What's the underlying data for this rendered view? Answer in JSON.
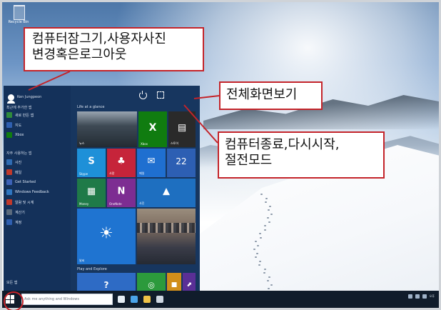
{
  "desktop": {
    "recycle_bin_label": "Recycle Bin"
  },
  "start_menu": {
    "user_name": "Ken Jungpeon",
    "left_sections": [
      {
        "label": "최근에 추가한 앱"
      },
      {
        "label": "자주 사용하는 앱"
      }
    ],
    "left_items": [
      {
        "label": "새로 만든 앱",
        "color": "#2f8a3c"
      },
      {
        "label": "지도",
        "color": "#2f5fb0"
      },
      {
        "label": "Xbox",
        "color": "#107c10"
      },
      {
        "label": "사진",
        "color": "#2f6cb3"
      },
      {
        "label": "메일",
        "color": "#c0392b"
      },
      {
        "label": "Get Started",
        "color": "#3d62b7"
      },
      {
        "label": "Windows Feedback",
        "color": "#2f76c0"
      },
      {
        "label": "알람 및 시계",
        "color": "#c0392b"
      },
      {
        "label": "계산기",
        "color": "#5b6b7d"
      },
      {
        "label": "계정",
        "color": "#2f5fb0"
      }
    ],
    "bottom_items": [
      {
        "label": "모든 앱"
      }
    ],
    "groups": [
      {
        "title": "Life at a glance"
      },
      {
        "title": "Play and Explore"
      }
    ],
    "tiles": [
      {
        "label": "뉴스",
        "glyph": "",
        "color": "#303a45"
      },
      {
        "label": "Xbox",
        "glyph": "X",
        "color": "#107c10"
      },
      {
        "label": "스토어",
        "glyph": "▤",
        "color": "#2a2a2a"
      },
      {
        "label": "Skype",
        "glyph": "S",
        "color": "#1e90d8"
      },
      {
        "label": "사람",
        "glyph": "♣",
        "color": "#c6243a"
      },
      {
        "label": "메일",
        "glyph": "✉",
        "color": "#1f6fd0"
      },
      {
        "label": "22",
        "glyph": "22",
        "color": "#2d5fb3"
      },
      {
        "label": "Money",
        "glyph": "▦",
        "color": "#1f7a48"
      },
      {
        "label": "OneNote",
        "glyph": "N",
        "color": "#7d2d92"
      },
      {
        "label": "사진",
        "glyph": "▲",
        "color": "#1e6fc0"
      },
      {
        "label": "날씨",
        "glyph": "☀",
        "color": "#1f74d1"
      },
      {
        "label": "",
        "glyph": "",
        "color": "#2a2f38"
      },
      {
        "label": "",
        "glyph": "?",
        "color": "#2e6bc5"
      },
      {
        "label": "",
        "glyph": "◎",
        "color": "#2c9a3c"
      },
      {
        "label": "",
        "glyph": "■",
        "color": "#d18e1a"
      },
      {
        "label": "",
        "glyph": "⬈",
        "color": "#5a2f96"
      }
    ]
  },
  "taskbar": {
    "search_placeholder": "Ask me anything and Windows",
    "tray_time": "오후"
  },
  "callouts": {
    "lock": {
      "line1": "컴퓨터잠그기,사용자사진",
      "line2": "변경혹은로그아웃"
    },
    "fullscreen": {
      "line1": "전체화면보기"
    },
    "power": {
      "line1": "컴퓨터종료,다시시작,",
      "line2": "절전모드"
    }
  },
  "colors": {
    "accent": "#c4242a",
    "start_menu_bg": "#17365f",
    "taskbar_bg": "#101c2b"
  }
}
